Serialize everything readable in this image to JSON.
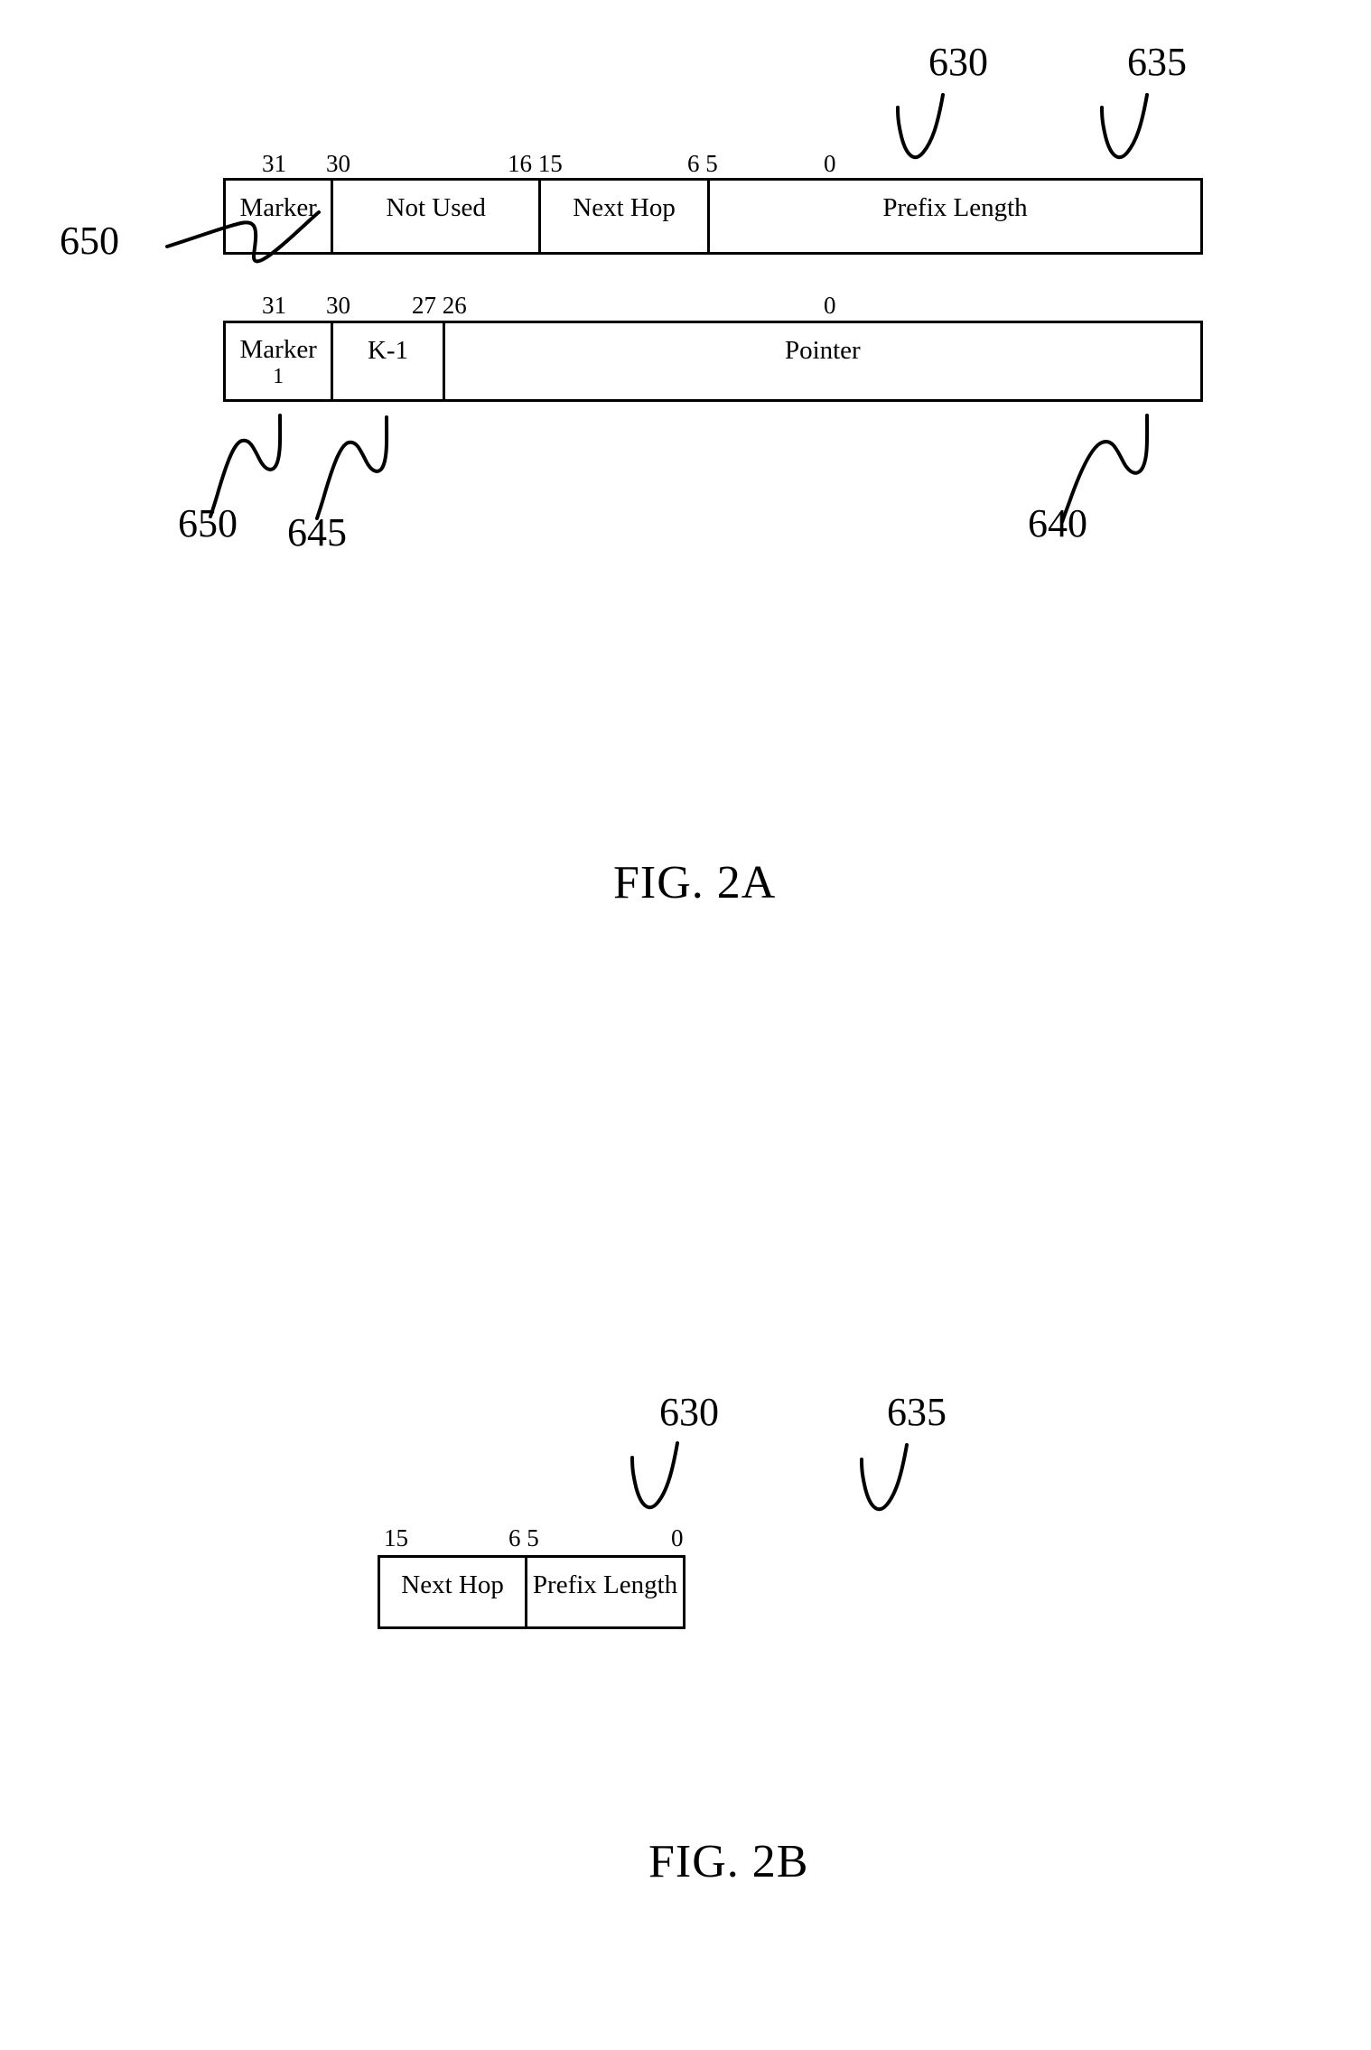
{
  "figures": [
    {
      "id": "fig-2a",
      "caption": "FIG. 2A",
      "tables": [
        {
          "id": "table-top",
          "bit_labels": [
            "31",
            "30",
            "16 15",
            "6 5",
            "0"
          ],
          "cells": [
            {
              "label": "Marker"
            },
            {
              "label": "Not Used"
            },
            {
              "label": "Next Hop"
            },
            {
              "label": "Prefix Length"
            }
          ]
        },
        {
          "id": "table-pointer",
          "bit_labels": [
            "31",
            "30",
            "27 26",
            "0"
          ],
          "cells": [
            {
              "label": "Marker",
              "sub": "1"
            },
            {
              "label": "K-1"
            },
            {
              "label": "Pointer"
            }
          ]
        }
      ],
      "reference_numerals": [
        {
          "value": "630"
        },
        {
          "value": "635"
        },
        {
          "value": "650"
        },
        {
          "value": "650"
        },
        {
          "value": "645"
        },
        {
          "value": "640"
        }
      ]
    },
    {
      "id": "fig-2b",
      "caption": "FIG. 2B",
      "tables": [
        {
          "id": "table-2b",
          "bit_labels": [
            "15",
            "6 5",
            "0"
          ],
          "cells": [
            {
              "label": "Next Hop"
            },
            {
              "label": "Prefix Length"
            }
          ]
        }
      ],
      "reference_numerals": [
        {
          "value": "630"
        },
        {
          "value": "635"
        }
      ]
    }
  ],
  "colors": {
    "ink": "#000000",
    "paper": "#ffffff"
  }
}
